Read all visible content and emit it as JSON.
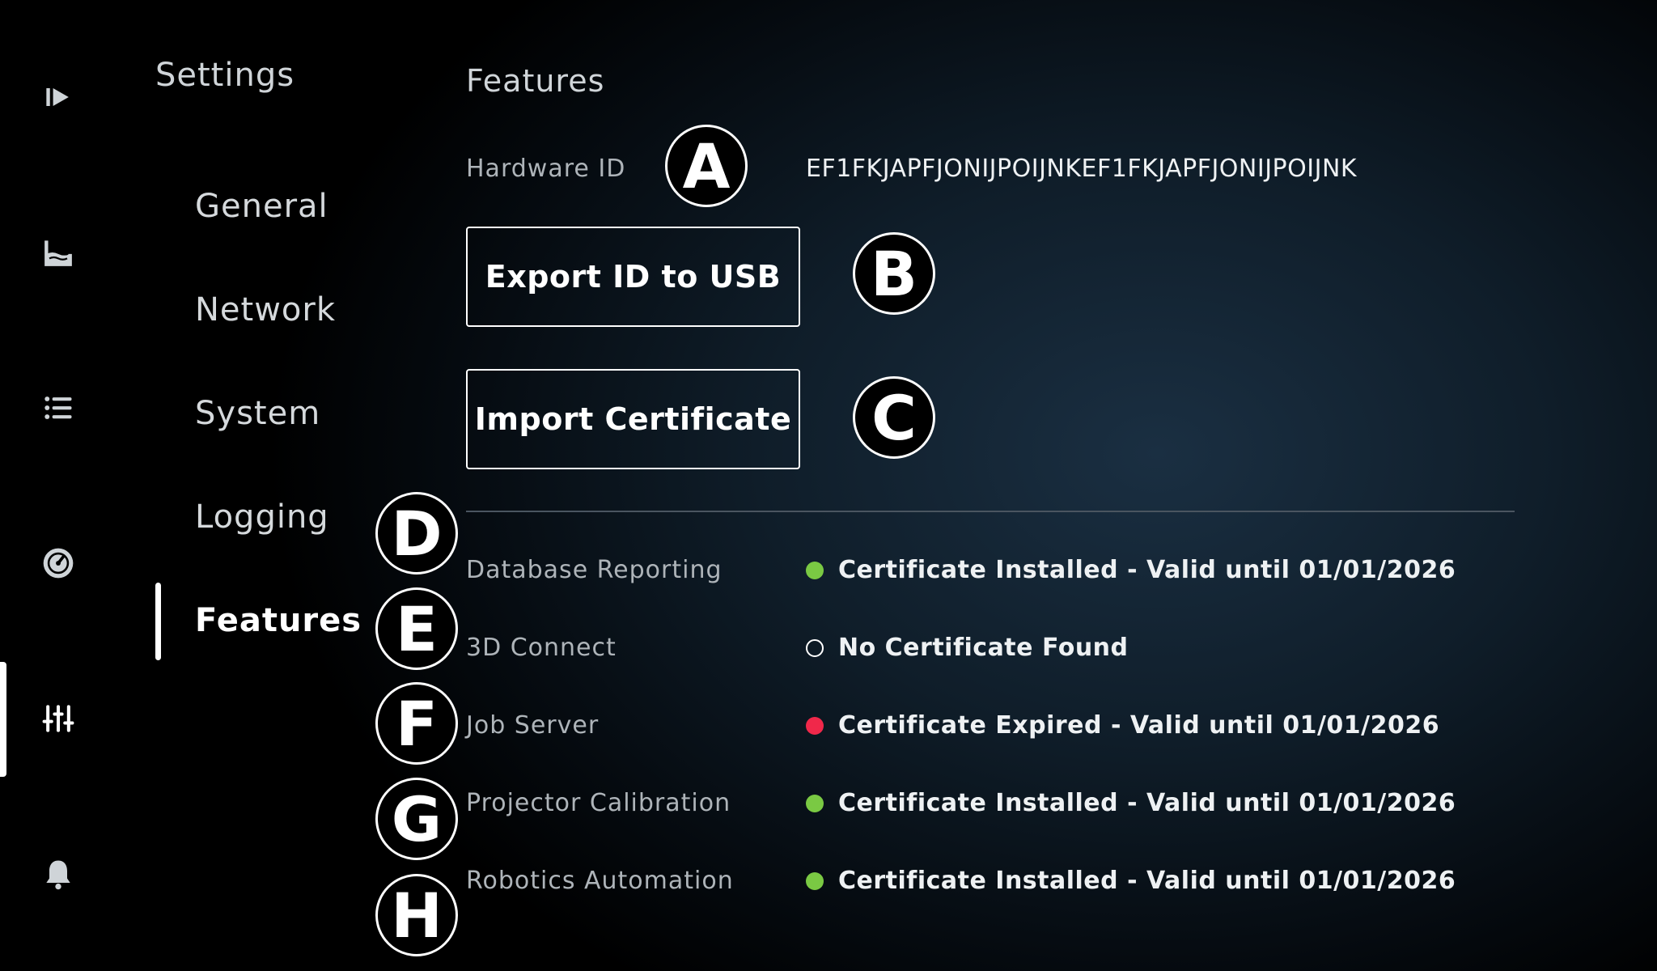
{
  "sidebar": {
    "icons": [
      "play-icon",
      "tank-icon",
      "list-icon",
      "gauge-icon",
      "sliders-icon",
      "bell-icon"
    ]
  },
  "settings": {
    "title": "Settings",
    "nav": [
      {
        "label": "General"
      },
      {
        "label": "Network"
      },
      {
        "label": "System"
      },
      {
        "label": "Logging"
      },
      {
        "label": "Features"
      }
    ],
    "active": "Features"
  },
  "features": {
    "title": "Features",
    "hardware_id_label": "Hardware ID",
    "hardware_id_value": "EF1FKJAPFJONIJPOIJNKEF1FKJAPFJONIJPOIJNK",
    "export_button": "Export ID to USB",
    "import_button": "Import Certificate",
    "items": [
      {
        "name": "Database Reporting",
        "status": "Certificate Installed - Valid until 01/01/2026",
        "state": "installed",
        "color": "#7ac943"
      },
      {
        "name": "3D Connect",
        "status": "No Certificate Found",
        "state": "none",
        "color": "#ffffff"
      },
      {
        "name": "Job Server",
        "status": "Certificate Expired - Valid until 01/01/2026",
        "state": "expired",
        "color": "#f0284a"
      },
      {
        "name": "Projector Calibration",
        "status": "Certificate Installed - Valid until 01/01/2026",
        "state": "installed",
        "color": "#7ac943"
      },
      {
        "name": "Robotics Automation",
        "status": "Certificate Installed - Valid until 01/01/2026",
        "state": "installed",
        "color": "#7ac943"
      }
    ]
  },
  "markers": [
    "A",
    "B",
    "C",
    "D",
    "E",
    "F",
    "G",
    "H"
  ]
}
